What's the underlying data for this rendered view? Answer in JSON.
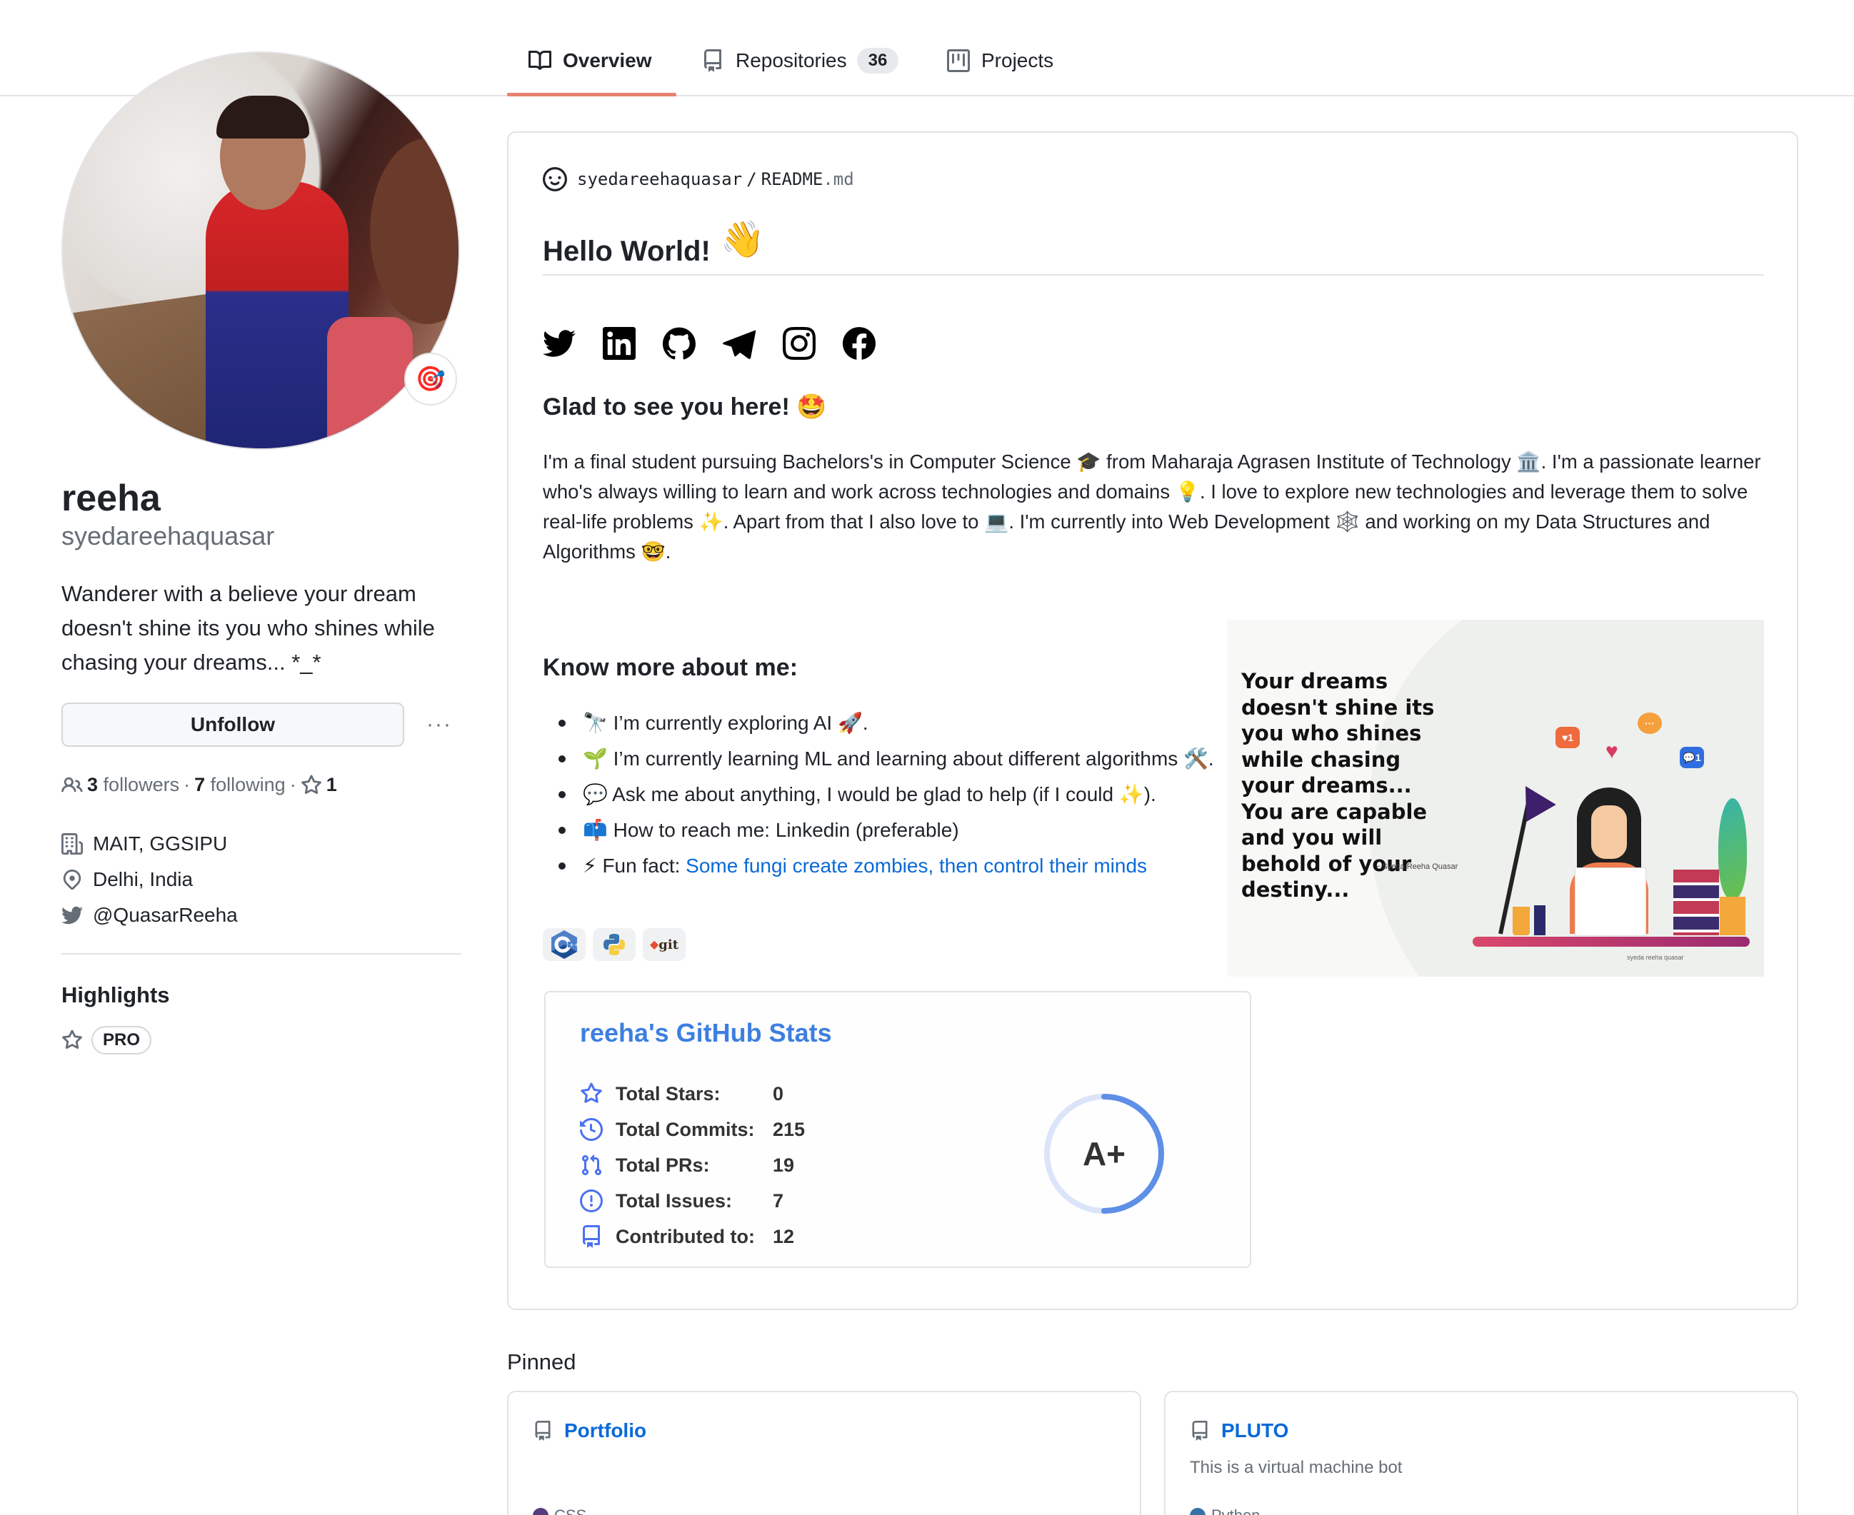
{
  "tabs": [
    {
      "label": "Overview",
      "icon": "book-icon",
      "active": true
    },
    {
      "label": "Repositories",
      "icon": "repo-icon",
      "count": "36"
    },
    {
      "label": "Projects",
      "icon": "project-icon"
    }
  ],
  "profile": {
    "status_emoji": "🎯",
    "name": "reeha",
    "login": "syedareehaquasar",
    "bio": "Wanderer with a believe your dream doesn't shine its you who shines while chasing your dreams... *_*",
    "unfollow_label": "Unfollow",
    "more_label": "···",
    "followers_count": "3",
    "followers_label": "followers",
    "following_count": "7",
    "following_label": "following",
    "stars_count": "1",
    "separator": "·",
    "organization": "MAIT, GGSIPU",
    "location": "Delhi, India",
    "twitter": "@QuasarReeha",
    "highlights_title": "Highlights",
    "highlight_badge": "PRO"
  },
  "readme": {
    "owner": "syedareehaquasar",
    "slash": "/",
    "file_base": "README",
    "file_ext": ".md",
    "heading": "Hello World!",
    "heading_emoji": "👋",
    "socials": [
      "twitter",
      "linkedin",
      "github",
      "telegram",
      "instagram",
      "facebook"
    ],
    "glad_heading": "Glad to see you here! 🤩",
    "intro": "I'm a final student pursuing Bachelors's in Computer Science 🎓 from Maharaja Agrasen Institute of Technology 🏛️. I'm a passionate learner who's always willing to learn and work across technologies and domains 💡. I love to explore new technologies and leverage them to solve real-life problems ✨. Apart from that I also love to 💻. I'm currently into Web Development 🕸️ and working on my Data Structures and Algorithms 🤓.",
    "know_heading": "Know more about me:",
    "bullets": [
      {
        "text": "🔭 I’m currently exploring AI 🚀."
      },
      {
        "text": "🌱 I’m currently learning ML and learning about different algorithms 🛠️."
      },
      {
        "text": "💬 Ask me about anything, I would be glad to help (if I could ✨)."
      },
      {
        "text": "📫 How to reach me: Linkedin (preferable)"
      },
      {
        "text": "⚡ Fun fact: ",
        "link": "Some fungi create zombies, then control their minds"
      }
    ],
    "tech_badges": [
      "C++",
      "Python",
      "git"
    ],
    "quote_image": {
      "text": "Your dreams doesn't shine its you who shines while chasing your dreams... You are capable and you will behold of your destiny...",
      "author": "~ Syeda Reeha Quasar",
      "signature": "syeda reeha quasar",
      "bubbles": [
        "♥1",
        "···",
        "♥",
        "💬1"
      ]
    },
    "stats": {
      "title": "reeha's GitHub Stats",
      "rows": [
        {
          "label": "Total Stars:",
          "value": "0",
          "icon": "star-icon"
        },
        {
          "label": "Total Commits:",
          "value": "215",
          "icon": "history-icon"
        },
        {
          "label": "Total PRs:",
          "value": "19",
          "icon": "pull-request-icon"
        },
        {
          "label": "Total Issues:",
          "value": "7",
          "icon": "issue-icon"
        },
        {
          "label": "Contributed to:",
          "value": "12",
          "icon": "repo-icon"
        }
      ],
      "rank": "A+",
      "rank_progress_percent": 50,
      "accent": "#4c71f2"
    }
  },
  "pinned": {
    "title": "Pinned",
    "repos": [
      {
        "name": "Portfolio",
        "description": "",
        "language": "CSS",
        "language_color": "#563d7c"
      },
      {
        "name": "PLUTO",
        "description": "This is a virtual machine bot",
        "language": "Python",
        "language_color": "#3572A5"
      }
    ]
  }
}
